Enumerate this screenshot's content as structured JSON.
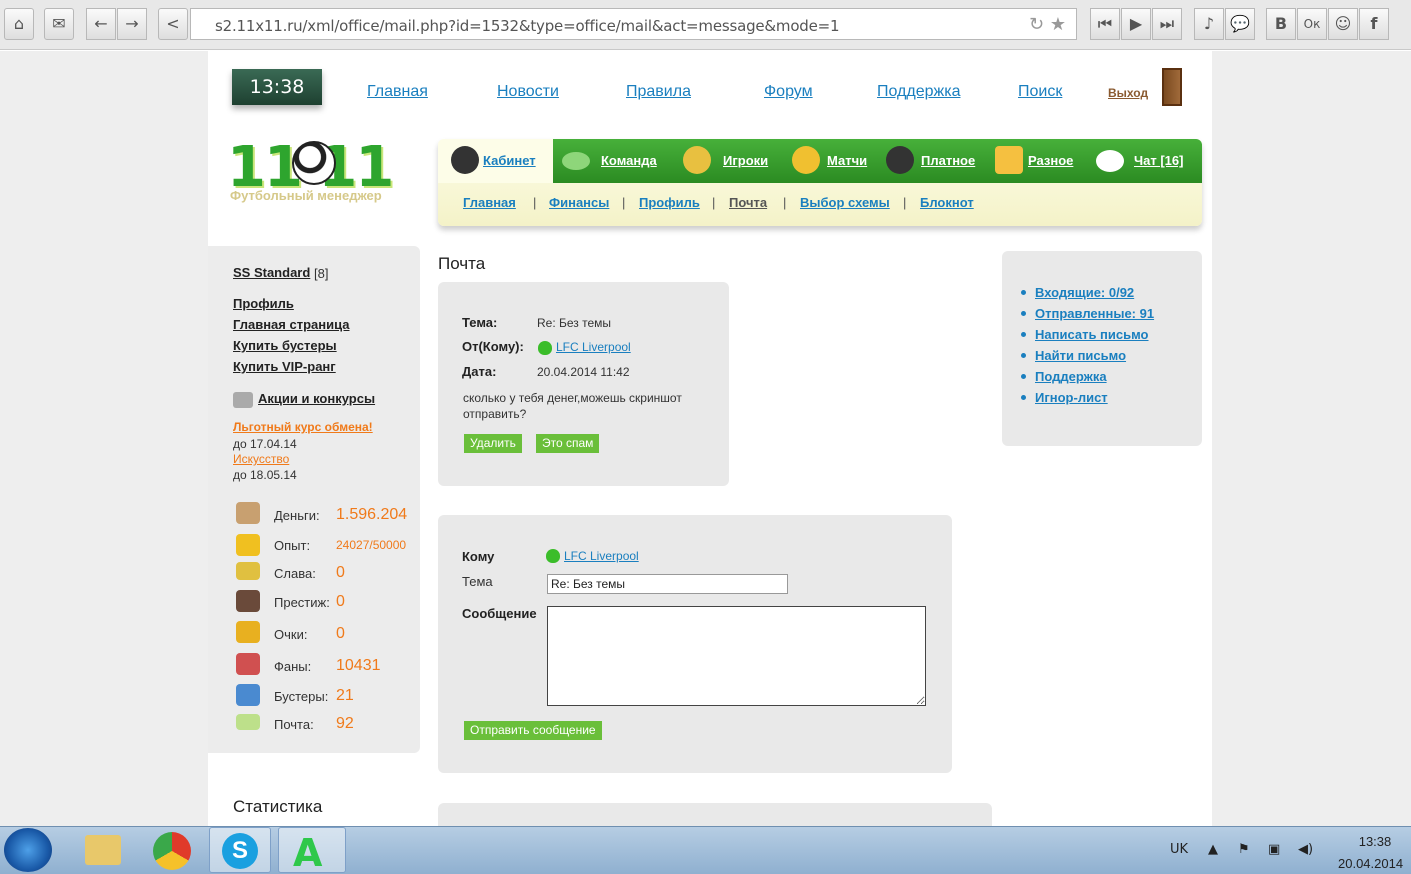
{
  "browser": {
    "url": "s2.11x11.ru/xml/office/mail.php?id=1532&type=office/mail&act=message&mode=1",
    "buttons": [
      "⌂",
      "✉",
      "←",
      "→",
      "<"
    ],
    "right_buttons": [
      "⏮",
      "▶",
      "⏭",
      "♪",
      "💬",
      "В",
      "Ок",
      "☺",
      "f"
    ]
  },
  "header": {
    "clock": "13:38",
    "nav": [
      "Главная",
      "Новости",
      "Правила",
      "Форум",
      "Поддержка",
      "Поиск"
    ],
    "exit": "Выход",
    "logo": "11  11",
    "logo_sub": "Футбольный менеджер"
  },
  "tabs": [
    "Кабинет",
    "Команда",
    "Игроки",
    "Матчи",
    "Платное",
    "Разное",
    "Чат [16]"
  ],
  "subnav": [
    "Главная",
    "Финансы",
    "Профиль",
    "Почта",
    "Выбор схемы",
    "Блокнот"
  ],
  "sidebar": {
    "team": "SS Standard",
    "team_rank": "[8]",
    "links": [
      "Профиль",
      "Главная страница",
      "Купить бустеры",
      "Купить VIP-ранг"
    ],
    "promo": "Акции и конкурсы",
    "offer1": "Льготный курс обмена!",
    "offer1_until": "до 17.04.14",
    "offer2": "Искусство",
    "offer2_until": "до 18.05.14",
    "stats": [
      {
        "label": "Деньги:",
        "value": "1.596.204"
      },
      {
        "label": "Опыт:",
        "value": "24027/50000"
      },
      {
        "label": "Слава:",
        "value": "0"
      },
      {
        "label": "Престиж:",
        "value": "0"
      },
      {
        "label": "Очки:",
        "value": "0"
      },
      {
        "label": "Фаны:",
        "value": "10431"
      },
      {
        "label": "Бустеры:",
        "value": "21"
      },
      {
        "label": "Почта:",
        "value": "92"
      }
    ],
    "stats_title": "Статистика"
  },
  "mail": {
    "title": "Почта",
    "subject_label": "Тема:",
    "subject": "Re: Без темы",
    "from_label": "От(Кому):",
    "from": "LFC Liverpool",
    "date_label": "Дата:",
    "date": "20.04.2014 11:42",
    "body": "сколько у тебя денег,можешь скриншот отправить?",
    "delete_btn": "Удалить",
    "spam_btn": "Это спам"
  },
  "reply": {
    "to_label": "Кому",
    "to": "LFC Liverpool",
    "subject_label": "Тема",
    "subject_value": "Re: Без темы",
    "message_label": "Сообщение",
    "send_btn": "Отправить сообщение"
  },
  "mailbox": {
    "items": [
      "Входящие: 0/92",
      "Отправленные: 91",
      "Написать письмо",
      "Найти письмо",
      "Поддержка",
      "Игнор-лист"
    ]
  },
  "taskbar": {
    "lang": "UK",
    "time": "13:38",
    "date": "20.04.2014"
  }
}
